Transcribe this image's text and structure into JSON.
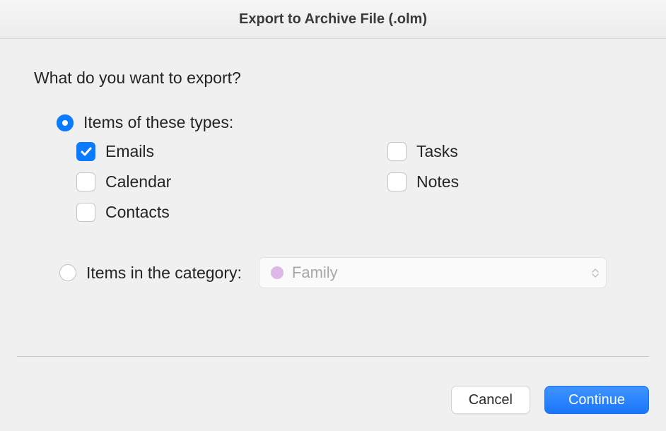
{
  "title": "Export to Archive File (.olm)",
  "prompt": "What do you want to export?",
  "option_types": {
    "label": "Items of these types:",
    "selected": true,
    "checkboxes": {
      "emails": {
        "label": "Emails",
        "checked": true
      },
      "calendar": {
        "label": "Calendar",
        "checked": false
      },
      "contacts": {
        "label": "Contacts",
        "checked": false
      },
      "tasks": {
        "label": "Tasks",
        "checked": false
      },
      "notes": {
        "label": "Notes",
        "checked": false
      }
    }
  },
  "option_category": {
    "label": "Items in the category:",
    "selected": false,
    "dropdown": {
      "value": "Family",
      "color": "#dcb8e6"
    }
  },
  "buttons": {
    "cancel": "Cancel",
    "continue": "Continue"
  }
}
